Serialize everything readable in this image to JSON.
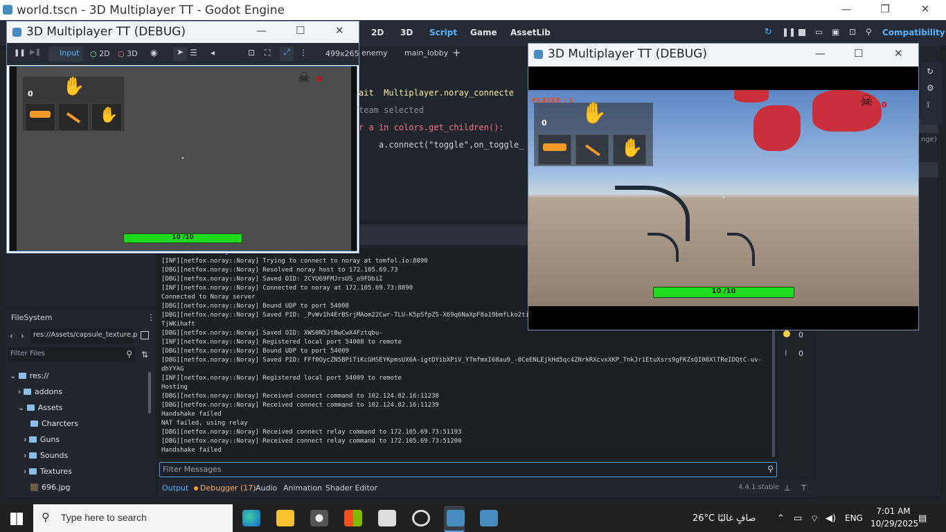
{
  "editor": {
    "title": "world.tscn - 3D Multiplayer TT - Godot Engine",
    "workspaces": [
      "2D",
      "3D",
      "Script",
      "Game",
      "AssetLib"
    ],
    "renderer": "Compatibility",
    "version": "4.4.1.stable"
  },
  "script_tabs": [
    "enemy",
    "main_lobby"
  ],
  "code": {
    "lines": [
      "ait  Multiplayer.noray_connecte",
      "team selected",
      "r a in colors.get_children():",
      "    a.connect(\"toggle\",on_toggle_"
    ]
  },
  "output": {
    "lines": [
      "Connected to Noray server",
      "[INF][netfox.noray::Noray] Trying to connect to noray at tomfol.io:8890",
      "[DBG][netfox.noray::Noray] Resolved noray host to 172.105.69.73",
      "[DBG][netfox.noray::Noray] Saved OID: 2CYU69FMJrsUS_o9FDbiI",
      "[INF][netfox.noray::Noray] Connected to noray at 172.105.69.73:8890",
      "Connected to Noray server",
      "[DBG][netfox.noray::Noray] Bound UDP to port 54008",
      "[DBG][netfox.noray::Noray] Saved PID: _PvWv1h4ErBSrjMAom22Cwr-TLU-K5pSfpZS-X69q6NaXpF8a19bmfLko2ti",
      "TjWKihaft",
      "[DBG][netfox.noray::Noray] Saved OID: XWS0N5JtBwCwX4Fztqbu-",
      "[INF][netfox.noray::Noray] Registered local port 54008 to remote",
      "[DBG][netfox.noray::Noray] Bound UDP to port 54009",
      "[DBG][netfox.noray::Noray] Saved PID: FFf0OycZN5BPiTiKcGHSEYKpmsUX6A-igtDYibXPiV_YTmfmxI68au9_-0CeENLEjkHd5qc4ZNrkRXcvxXKP_TnkJr1EtuXsrs9gFKZsQI08XlTReIDQtC-uv-",
      "dhYYAG",
      "[INF][netfox.noray::Noray] Registered local port 54009 to remote",
      "Hosting",
      "[DBG][netfox.noray::Noray] Received connect command to 102.124.82.16:11238",
      "[DBG][netfox.noray::Noray] Received connect command to 102.124.82.16:11239",
      "Handshake failed",
      "NAT failed, using relay",
      "[DBG][netfox.noray::Noray] Received connect relay command to 172.105.69.73:51193",
      "[DBG][netfox.noray::Noray] Received connect relay command to 172.105.69.73:51200",
      "Handshake failed"
    ],
    "filter_placeholder": "Filter Messages"
  },
  "bottom_tabs": [
    "Output",
    "Debugger (17)",
    "Audio",
    "Animation",
    "Shader Editor"
  ],
  "counters": [
    "0",
    "0"
  ],
  "filesystem": {
    "title": "FileSystem",
    "path": "res://Assets/capsule_texture.p",
    "filter_placeholder": "Filter Files",
    "tree": [
      {
        "label": "res://",
        "indent": 0
      },
      {
        "label": "addons",
        "indent": 1
      },
      {
        "label": "Assets",
        "indent": 1
      },
      {
        "label": "Charcters",
        "indent": 2
      },
      {
        "label": "Guns",
        "indent": 2
      },
      {
        "label": "Sounds",
        "indent": 2
      },
      {
        "label": "Textures",
        "indent": 2
      },
      {
        "label": "696.jpg",
        "indent": 2
      }
    ]
  },
  "right_dock": {
    "hint": "nge)"
  },
  "debug_left": {
    "title": "3D Multiplayer TT (DEBUG)",
    "toolbar": {
      "input": "Input",
      "twod": "2D",
      "threed": "3D",
      "size": "499x265"
    },
    "score": "0",
    "kills": "0",
    "health": "10 /10"
  },
  "debug_right": {
    "title": "3D Multiplayer TT (DEBUG)",
    "player": "PLAYER : 1",
    "score": "0",
    "kills": "0",
    "health": "10 /10"
  },
  "taskbar": {
    "search": "Type here to search",
    "weather": "26°C  صافٍ غالبًا",
    "lang": "ENG",
    "time": "7:01 AM",
    "date": "10/29/2025"
  },
  "colors": {
    "accent": "#57b3ff",
    "health": "#1fdb1f",
    "godot": "#478cbf"
  }
}
